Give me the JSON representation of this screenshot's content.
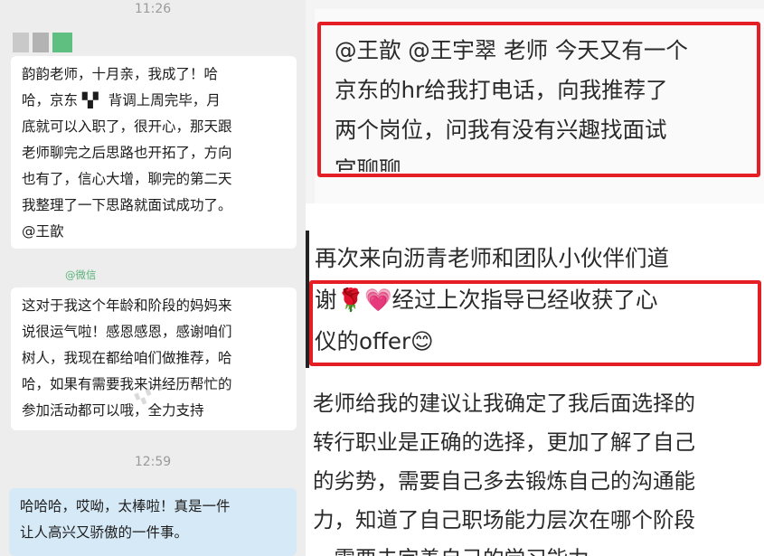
{
  "left_chat": {
    "time_top": "11:26",
    "avatar_colors": [
      "#c9c9c9",
      "#b3b3b3",
      "#5fbf80"
    ],
    "msg1_lines": [
      "韵韵老师，十月亲，我成了！哈",
      "哈，京东 ▚▘ 背调上周完毕，月",
      "底就可以入职了，很开心，那天跟",
      "老师聊完之后思路也开拓了，方向",
      "也有了，信心大增，聊完的第二天",
      "我整理了一下思路就面试成功了。",
      "@王歆"
    ],
    "wechat_tag": "@微信",
    "msg2_lines": [
      "这对于我这个年龄和阶段的妈妈来",
      "说很运气啦！感恩感恩，感谢咱们",
      "树人，我现在都给咱们做推荐，哈",
      "哈，如果有需要我来讲经历帮忙的",
      "参加活动都可以哦，全力支持"
    ],
    "time_mid": "12:59",
    "msg3_lines": [
      "哈哈哈，哎呦，太棒啦！真是一件",
      "让人高兴又骄傲的一件事。"
    ]
  },
  "right_top": {
    "lines": [
      "@王歆 @王宇翠 老师 今天又有一个",
      "京东的hr给我打电话，向我推荐了",
      "两个岗位，问我有没有兴趣找面试",
      "官聊聊"
    ]
  },
  "right_mid": {
    "line1": "再次来向沥青老师和团队小伙伴们道",
    "line2": "谢🌹💗经过上次指导已经收获了心",
    "line3": "仪的offer😊"
  },
  "right_bottom": {
    "lines": [
      "老师给我的建议让我确定了我后面选择的",
      "转行职业是正确的选择，更加了解了自己",
      "的劣势，需要自己多去锻炼自己的沟通能",
      "力，知道了自己职场能力层次在哪个阶段",
      "，需要去完善自己的学习能力"
    ]
  },
  "colors": {
    "highlight_red": "#e51e25",
    "wechat_green": "#5ab37a",
    "bubble_blue": "#d6e9f6"
  }
}
